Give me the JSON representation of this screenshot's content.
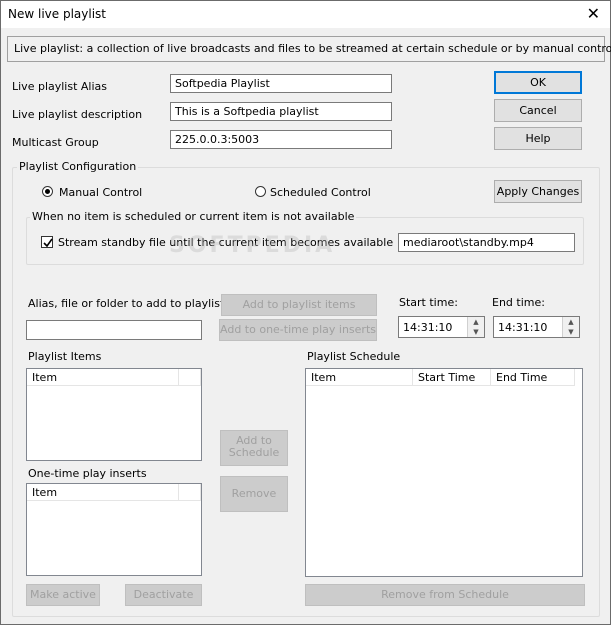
{
  "window": {
    "title": "New live playlist",
    "close_glyph": "✕"
  },
  "info": {
    "text": "Live playlist: a collection of live broadcasts and files to be streamed at certain schedule or by manual control"
  },
  "fields": {
    "alias_label": "Live playlist Alias",
    "alias_value": "Softpedia Playlist",
    "description_label": "Live playlist description",
    "description_value": "This is a Softpedia playlist",
    "multicast_label": "Multicast Group",
    "multicast_value": "225.0.0.3:5003"
  },
  "buttons": {
    "ok": "OK",
    "cancel": "Cancel",
    "help": "Help",
    "apply": "Apply Changes",
    "add_to_playlist": "Add to playlist items",
    "add_one_time": "Add to one-time play inserts",
    "add_to_schedule_1": "Add to",
    "add_to_schedule_2": "Schedule",
    "remove": "Remove",
    "make_active": "Make active",
    "deactivate": "Deactivate",
    "remove_from_schedule": "Remove from Schedule"
  },
  "config": {
    "group_label": "Playlist Configuration",
    "manual_label": "Manual Control",
    "scheduled_label": "Scheduled Control",
    "selected_mode": "manual",
    "standby_group_label": "When no item is scheduled or current item is not available",
    "standby_check_label": "Stream standby file until the current item becomes available",
    "standby_checked": true,
    "standby_file": "mediaroot\\standby.mp4"
  },
  "add_section": {
    "alias_prompt": "Alias, file or folder to add to playlist:",
    "alias_input": "",
    "start_label": "Start time:",
    "start_value": "14:31:10",
    "end_label": "End time:",
    "end_value": "14:31:10"
  },
  "lists": {
    "playlist_items_label": "Playlist Items",
    "playlist_items_header": "Item",
    "one_time_label": "One-time play inserts",
    "one_time_header": "Item",
    "schedule_label": "Playlist Schedule",
    "schedule_headers": [
      "Item",
      "Start Time",
      "End Time"
    ]
  },
  "watermark": "SOFTPEDIA"
}
